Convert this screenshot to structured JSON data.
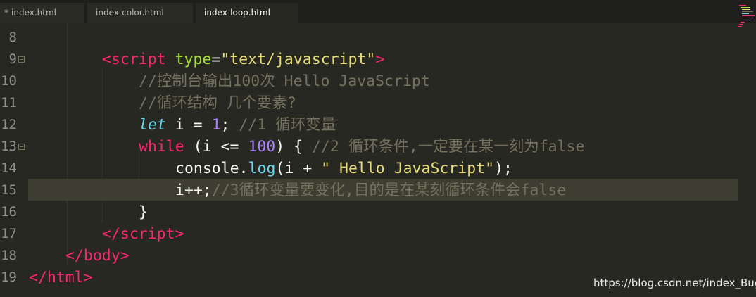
{
  "tabs": [
    {
      "label": "index.html",
      "modified": true,
      "modified_marker": "*"
    },
    {
      "label": "index-color.html",
      "modified": false
    },
    {
      "label": "index-loop.html",
      "modified": false,
      "active": true
    }
  ],
  "line_numbers": [
    "8",
    "9",
    "10",
    "11",
    "12",
    "13",
    "14",
    "15",
    "16",
    "17",
    "18",
    "19"
  ],
  "code": {
    "l9": {
      "indent": "        ",
      "open": "<",
      "tag": "script",
      "attr": "type",
      "eq": "=",
      "val": "\"text/javascript\"",
      "close": ">"
    },
    "l10": {
      "comment": "//控制台输出100次 Hello JavaScript"
    },
    "l11": {
      "comment": "//循环结构 几个要素?"
    },
    "l12": {
      "kw": "let",
      "mid": " i = ",
      "num": "1",
      "end": "; ",
      "comment": "//1 循环变量"
    },
    "l13": {
      "kw": "while",
      "mid": " (i <= ",
      "num": "100",
      "end": ") { ",
      "comment": "//2 循环条件,一定要在某一刻为false"
    },
    "l14": {
      "obj": "console.",
      "fn": "log",
      "mid": "(i + ",
      "str": "\" Hello JavaScript\"",
      "end": ");"
    },
    "l15": {
      "code": "i++;",
      "comment": "//3循环变量要变化,目的是在某刻循环条件会false"
    },
    "l16": {
      "code": "}"
    },
    "l17": {
      "open": "</",
      "tag": "script",
      "close": ">"
    },
    "l18": {
      "open": "</",
      "tag": "body",
      "close": ">"
    },
    "l19": {
      "open": "</",
      "tag": "html",
      "close": ">"
    }
  },
  "theme": {
    "background": "#272822",
    "tag": "#f92672",
    "attribute": "#a6e22e",
    "string": "#e6db74",
    "comment": "#75715e",
    "number": "#ae81ff",
    "function": "#66d9ef"
  },
  "watermark": "https://blog.csdn.net/index_Bug"
}
